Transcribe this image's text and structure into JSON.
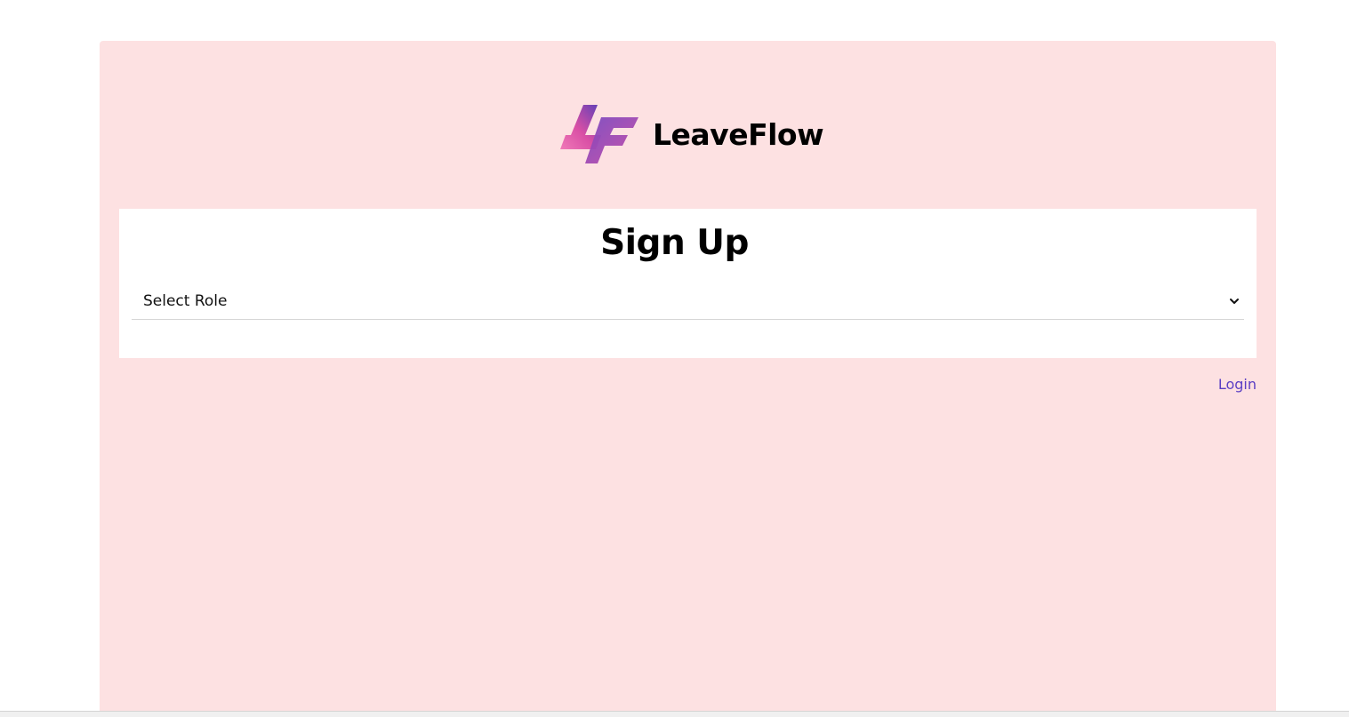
{
  "app": {
    "brand_name": "LeaveFlow",
    "logo_icon": "leaveflow-logo-icon",
    "colors": {
      "panel_background": "#fde1e2",
      "card_background": "#ffffff",
      "link": "#5b3fc4",
      "logo_gradient_start": "#ec5aa6",
      "logo_gradient_end": "#6a43b8"
    }
  },
  "signup": {
    "title": "Sign Up",
    "role_select": {
      "selected_value": "Select Role",
      "icon": "chevron-down-icon"
    }
  },
  "footer_links": {
    "login_label": "Login"
  }
}
